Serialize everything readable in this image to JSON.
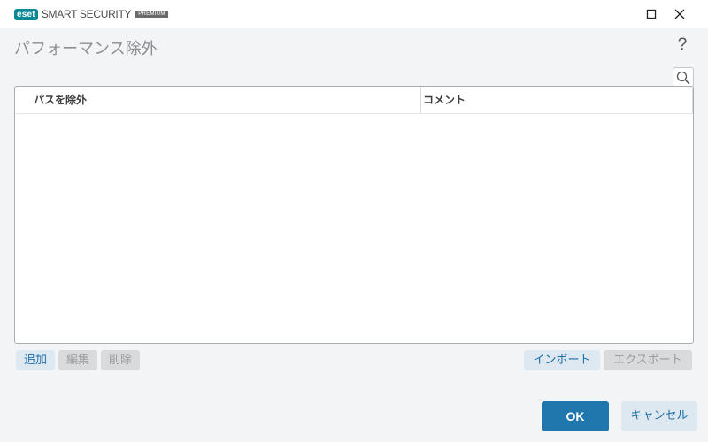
{
  "titlebar": {
    "brand": "eset",
    "product": "SMART SECURITY",
    "edition": "PREMIUM",
    "brand_color": "#0a8a94",
    "icons": [
      "minimize-icon",
      "maximize-icon",
      "close-icon"
    ]
  },
  "header": {
    "title": "パフォーマンス除外",
    "help_label": "?"
  },
  "search": {
    "icon": "search-icon"
  },
  "table": {
    "columns": [
      "パスを除外",
      "コメント"
    ],
    "rows": []
  },
  "toolbar": {
    "add_label": "追加",
    "edit_label": "編集",
    "delete_label": "削除",
    "import_label": "インポート",
    "export_label": "エクスポート"
  },
  "footer": {
    "ok_label": "OK",
    "cancel_label": "キャンセル",
    "accent_color": "#1f77ae"
  }
}
